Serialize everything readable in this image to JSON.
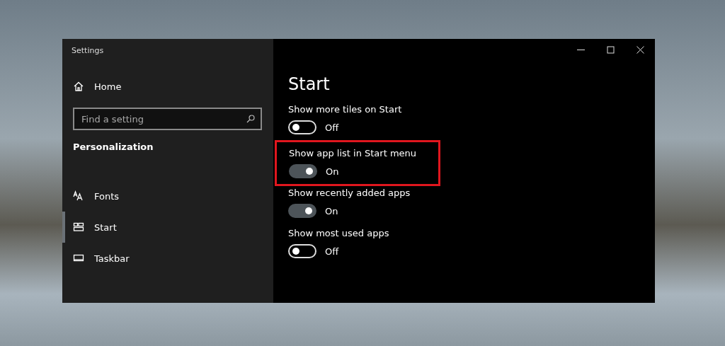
{
  "window": {
    "title": "Settings"
  },
  "sidebar": {
    "home": "Home",
    "search": {
      "placeholder": "Find a setting"
    },
    "section": "Personalization",
    "items": [
      {
        "label": "Fonts",
        "kind": "fonts",
        "selected": false
      },
      {
        "label": "Start",
        "kind": "start",
        "selected": true
      },
      {
        "label": "Taskbar",
        "kind": "taskbar",
        "selected": false
      }
    ]
  },
  "page": {
    "title": "Start",
    "settings": [
      {
        "label": "Show more tiles on Start",
        "on": false,
        "state_label": "Off",
        "highlighted": false
      },
      {
        "label": "Show app list in Start menu",
        "on": true,
        "state_label": "On",
        "highlighted": true
      },
      {
        "label": "Show recently added apps",
        "on": true,
        "state_label": "On",
        "highlighted": false
      },
      {
        "label": "Show most used apps",
        "on": false,
        "state_label": "Off",
        "highlighted": false
      }
    ]
  }
}
